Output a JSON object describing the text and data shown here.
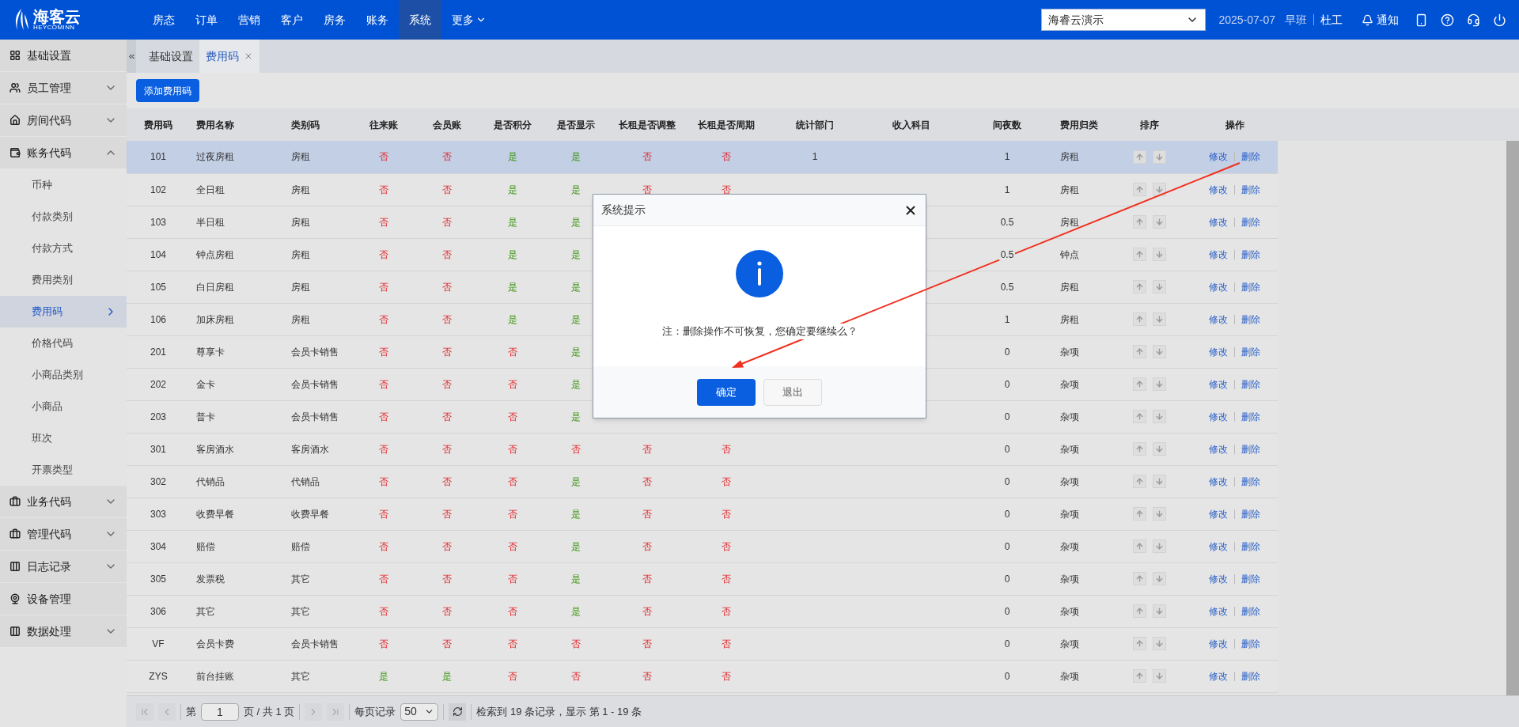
{
  "brand": {
    "name": "海客云",
    "subtitle": "HEYCOMINN"
  },
  "nav": [
    {
      "label": "房态",
      "selected": false
    },
    {
      "label": "订单",
      "selected": false
    },
    {
      "label": "营销",
      "selected": false
    },
    {
      "label": "客户",
      "selected": false
    },
    {
      "label": "房务",
      "selected": false
    },
    {
      "label": "账务",
      "selected": false
    },
    {
      "label": "系统",
      "selected": true
    },
    {
      "label": "更多",
      "selected": false,
      "dropdown": true
    }
  ],
  "hotel_select": {
    "value": "海睿云演示"
  },
  "date": "2025-07-07",
  "shift": "早班",
  "user": "杜工",
  "notify": "通知",
  "sidebar": [
    {
      "label": "基础设置"
    },
    {
      "label": "员工管理",
      "expanded": false
    },
    {
      "label": "房间代码",
      "expanded": false
    },
    {
      "label": "账务代码",
      "expanded": true,
      "children": [
        {
          "label": "币种",
          "selected": false
        },
        {
          "label": "付款类别",
          "selected": false
        },
        {
          "label": "付款方式",
          "selected": false
        },
        {
          "label": "费用类别",
          "selected": false
        },
        {
          "label": "费用码",
          "selected": true
        },
        {
          "label": "价格代码",
          "selected": false
        },
        {
          "label": "小商品类别",
          "selected": false
        },
        {
          "label": "小商品",
          "selected": false
        },
        {
          "label": "班次",
          "selected": false
        },
        {
          "label": "开票类型",
          "selected": false
        }
      ]
    },
    {
      "label": "业务代码",
      "expanded": false
    },
    {
      "label": "管理代码",
      "expanded": false
    },
    {
      "label": "日志记录",
      "expanded": false
    },
    {
      "label": "设备管理"
    },
    {
      "label": "数据处理",
      "expanded": false
    }
  ],
  "tabs": [
    {
      "label": "基础设置",
      "selected": false,
      "closable": false
    },
    {
      "label": "费用码",
      "selected": true,
      "closable": true
    }
  ],
  "add_button": "添加费用码",
  "table": {
    "columns": [
      "费用码",
      "费用名称",
      "类别码",
      "往来账",
      "会员账",
      "是否积分",
      "是否显示",
      "长租是否调整",
      "长租是否周期",
      "统计部门",
      "收入科目",
      "间夜数",
      "费用归类",
      "排序",
      "操作"
    ],
    "rows": [
      {
        "code": "101",
        "name": "过夜房租",
        "category": "房租",
        "selected": true,
        "flags": [
          {
            "text": "否",
            "yes": false
          },
          {
            "text": "否",
            "yes": false
          },
          {
            "text": "是",
            "yes": true
          },
          {
            "text": "是",
            "yes": true
          },
          {
            "text": "否",
            "yes": false
          },
          {
            "text": "否",
            "yes": false
          }
        ],
        "dept": "1",
        "nights": "1",
        "group": "房租",
        "edit": "修改",
        "delete": "删除"
      },
      {
        "code": "102",
        "name": "全日租",
        "category": "房租",
        "selected": false,
        "flags": [
          {
            "text": "否",
            "yes": false
          },
          {
            "text": "否",
            "yes": false
          },
          {
            "text": "是",
            "yes": true
          },
          {
            "text": "是",
            "yes": true
          },
          {
            "text": "否",
            "yes": false
          },
          {
            "text": "否",
            "yes": false
          }
        ],
        "nights": "1",
        "group": "房租",
        "edit": "修改",
        "delete": "删除"
      },
      {
        "code": "103",
        "name": "半日租",
        "category": "房租",
        "selected": false,
        "flags": [
          {
            "text": "否",
            "yes": false
          },
          {
            "text": "否",
            "yes": false
          },
          {
            "text": "是",
            "yes": true
          },
          {
            "text": "是",
            "yes": true
          }
        ],
        "nights": "0.5",
        "group": "房租",
        "edit": "修改",
        "delete": "删除"
      },
      {
        "code": "104",
        "name": "钟点房租",
        "category": "房租",
        "selected": false,
        "flags": [
          {
            "text": "否",
            "yes": false
          },
          {
            "text": "否",
            "yes": false
          },
          {
            "text": "是",
            "yes": true
          },
          {
            "text": "是",
            "yes": true
          }
        ],
        "nights": "0.5",
        "group": "钟点",
        "edit": "修改",
        "delete": "删除"
      },
      {
        "code": "105",
        "name": "白日房租",
        "category": "房租",
        "selected": false,
        "flags": [
          {
            "text": "否",
            "yes": false
          },
          {
            "text": "否",
            "yes": false
          },
          {
            "text": "是",
            "yes": true
          },
          {
            "text": "是",
            "yes": true
          }
        ],
        "nights": "0.5",
        "group": "房租",
        "edit": "修改",
        "delete": "删除"
      },
      {
        "code": "106",
        "name": "加床房租",
        "category": "房租",
        "selected": false,
        "flags": [
          {
            "text": "否",
            "yes": false
          },
          {
            "text": "否",
            "yes": false
          },
          {
            "text": "是",
            "yes": true
          },
          {
            "text": "是",
            "yes": true
          }
        ],
        "nights": "1",
        "group": "房租",
        "edit": "修改",
        "delete": "删除"
      },
      {
        "code": "201",
        "name": "尊享卡",
        "category": "会员卡销售",
        "selected": false,
        "flags": [
          {
            "text": "否",
            "yes": false
          },
          {
            "text": "否",
            "yes": false
          },
          {
            "text": "否",
            "yes": false
          },
          {
            "text": "是",
            "yes": true
          }
        ],
        "nights": "0",
        "group": "杂项",
        "edit": "修改",
        "delete": "删除"
      },
      {
        "code": "202",
        "name": "金卡",
        "category": "会员卡销售",
        "selected": false,
        "flags": [
          {
            "text": "否",
            "yes": false
          },
          {
            "text": "否",
            "yes": false
          },
          {
            "text": "否",
            "yes": false
          },
          {
            "text": "是",
            "yes": true
          }
        ],
        "nights": "0",
        "group": "杂项",
        "edit": "修改",
        "delete": "删除"
      },
      {
        "code": "203",
        "name": "普卡",
        "category": "会员卡销售",
        "selected": false,
        "flags": [
          {
            "text": "否",
            "yes": false
          },
          {
            "text": "否",
            "yes": false
          },
          {
            "text": "否",
            "yes": false
          },
          {
            "text": "是",
            "yes": true
          }
        ],
        "nights": "0",
        "group": "杂项",
        "edit": "修改",
        "delete": "删除"
      },
      {
        "code": "301",
        "name": "客房酒水",
        "category": "客房酒水",
        "selected": false,
        "flags": [
          {
            "text": "否",
            "yes": false
          },
          {
            "text": "否",
            "yes": false
          },
          {
            "text": "否",
            "yes": false
          },
          {
            "text": "否",
            "yes": false
          },
          {
            "text": "否",
            "yes": false
          },
          {
            "text": "否",
            "yes": false
          }
        ],
        "nights": "0",
        "group": "杂项",
        "edit": "修改",
        "delete": "删除"
      },
      {
        "code": "302",
        "name": "代销品",
        "category": "代销品",
        "selected": false,
        "flags": [
          {
            "text": "否",
            "yes": false
          },
          {
            "text": "否",
            "yes": false
          },
          {
            "text": "否",
            "yes": false
          },
          {
            "text": "是",
            "yes": true
          },
          {
            "text": "否",
            "yes": false
          },
          {
            "text": "否",
            "yes": false
          }
        ],
        "nights": "0",
        "group": "杂项",
        "edit": "修改",
        "delete": "删除"
      },
      {
        "code": "303",
        "name": "收费早餐",
        "category": "收费早餐",
        "selected": false,
        "flags": [
          {
            "text": "否",
            "yes": false
          },
          {
            "text": "否",
            "yes": false
          },
          {
            "text": "否",
            "yes": false
          },
          {
            "text": "是",
            "yes": true
          },
          {
            "text": "否",
            "yes": false
          },
          {
            "text": "否",
            "yes": false
          }
        ],
        "nights": "0",
        "group": "杂项",
        "edit": "修改",
        "delete": "删除"
      },
      {
        "code": "304",
        "name": "赔偿",
        "category": "赔偿",
        "selected": false,
        "flags": [
          {
            "text": "否",
            "yes": false
          },
          {
            "text": "否",
            "yes": false
          },
          {
            "text": "否",
            "yes": false
          },
          {
            "text": "是",
            "yes": true
          },
          {
            "text": "否",
            "yes": false
          },
          {
            "text": "否",
            "yes": false
          }
        ],
        "nights": "0",
        "group": "杂项",
        "edit": "修改",
        "delete": "删除"
      },
      {
        "code": "305",
        "name": "发票税",
        "category": "其它",
        "selected": false,
        "flags": [
          {
            "text": "否",
            "yes": false
          },
          {
            "text": "否",
            "yes": false
          },
          {
            "text": "否",
            "yes": false
          },
          {
            "text": "是",
            "yes": true
          },
          {
            "text": "否",
            "yes": false
          },
          {
            "text": "否",
            "yes": false
          }
        ],
        "nights": "0",
        "group": "杂项",
        "edit": "修改",
        "delete": "删除"
      },
      {
        "code": "306",
        "name": "其它",
        "category": "其它",
        "selected": false,
        "flags": [
          {
            "text": "否",
            "yes": false
          },
          {
            "text": "否",
            "yes": false
          },
          {
            "text": "否",
            "yes": false
          },
          {
            "text": "是",
            "yes": true
          },
          {
            "text": "否",
            "yes": false
          },
          {
            "text": "否",
            "yes": false
          }
        ],
        "nights": "0",
        "group": "杂项",
        "edit": "修改",
        "delete": "删除"
      },
      {
        "code": "VF",
        "name": "会员卡费",
        "category": "会员卡销售",
        "selected": false,
        "flags": [
          {
            "text": "否",
            "yes": false
          },
          {
            "text": "否",
            "yes": false
          },
          {
            "text": "否",
            "yes": false
          },
          {
            "text": "否",
            "yes": false
          },
          {
            "text": "否",
            "yes": false
          },
          {
            "text": "否",
            "yes": false
          }
        ],
        "nights": "0",
        "group": "杂项",
        "edit": "修改",
        "delete": "删除"
      },
      {
        "code": "ZYS",
        "name": "前台挂账",
        "category": "其它",
        "selected": false,
        "flags": [
          {
            "text": "是",
            "yes": true
          },
          {
            "text": "是",
            "yes": true
          },
          {
            "text": "否",
            "yes": false
          },
          {
            "text": "否",
            "yes": false
          },
          {
            "text": "否",
            "yes": false
          },
          {
            "text": "否",
            "yes": false
          }
        ],
        "nights": "0",
        "group": "杂项",
        "edit": "修改",
        "delete": "删除"
      }
    ]
  },
  "pager": {
    "page_prefix": "第",
    "page": "1",
    "page_suffix": "页 / 共 1 页",
    "per_page_label": "每页记录",
    "per_page": "50",
    "summary": "检索到 19 条记录，显示 第 1 - 19 条"
  },
  "dialog": {
    "title": "系统提示",
    "message": "注：删除操作不可恢复，您确定要继续么？",
    "buttons": [
      {
        "label": "确定",
        "kind": "primary"
      },
      {
        "label": "退出",
        "kind": "secondary"
      }
    ]
  }
}
